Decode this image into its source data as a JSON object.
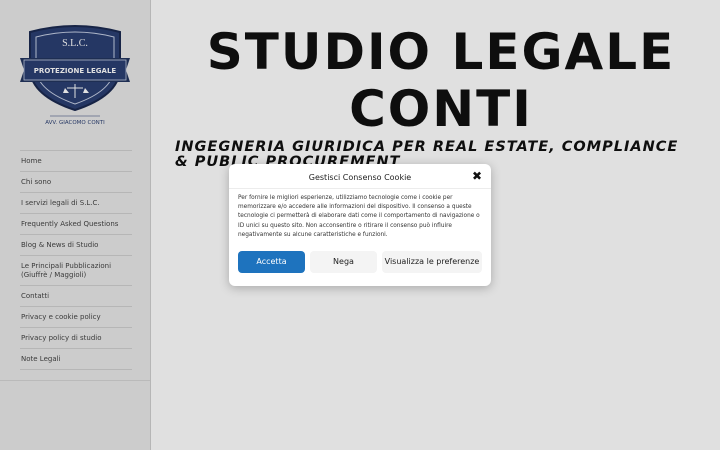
{
  "logo": {
    "initials": "S.L.C.",
    "banner": "PROTEZIONE LEGALE",
    "owner": "AVV. GIACOMO CONTI"
  },
  "nav": {
    "items": [
      {
        "label": "Home"
      },
      {
        "label": "Chi sono"
      },
      {
        "label": "I servizi legali di S.L.C."
      },
      {
        "label": "Frequently Asked Questions"
      },
      {
        "label": "Blog & News di Studio"
      },
      {
        "label": "Le Principali Pubblicazioni (Giuffrè / Maggioli)"
      },
      {
        "label": "Contatti"
      },
      {
        "label": "Privacy e cookie policy"
      },
      {
        "label": "Privacy policy di studio"
      },
      {
        "label": "Note Legali"
      }
    ]
  },
  "main": {
    "site_title": "STUDIO LEGALE CONTI",
    "tagline": "INGEGNERIA GIURIDICA PER REAL ESTATE, COMPLIANCE & PUBLIC PROCUREMENT"
  },
  "consent": {
    "title": "Gestisci Consenso Cookie",
    "close_symbol": "✖",
    "body": "Per fornire le migliori esperienze, utilizziamo tecnologie come i cookie per memorizzare e/o accedere alle informazioni del dispositivo. Il consenso a queste tecnologie ci permetterà di elaborare dati come il comportamento di navigazione o ID unici su questo sito. Non acconsentire o ritirare il consenso può influire negativamente su alcune caratteristiche e funzioni.",
    "accept_label": "Accetta",
    "deny_label": "Nega",
    "preferences_label": "Visualizza le preferenze"
  },
  "colors": {
    "accent": "#1e73be",
    "logo_navy": "#2b3f72"
  }
}
